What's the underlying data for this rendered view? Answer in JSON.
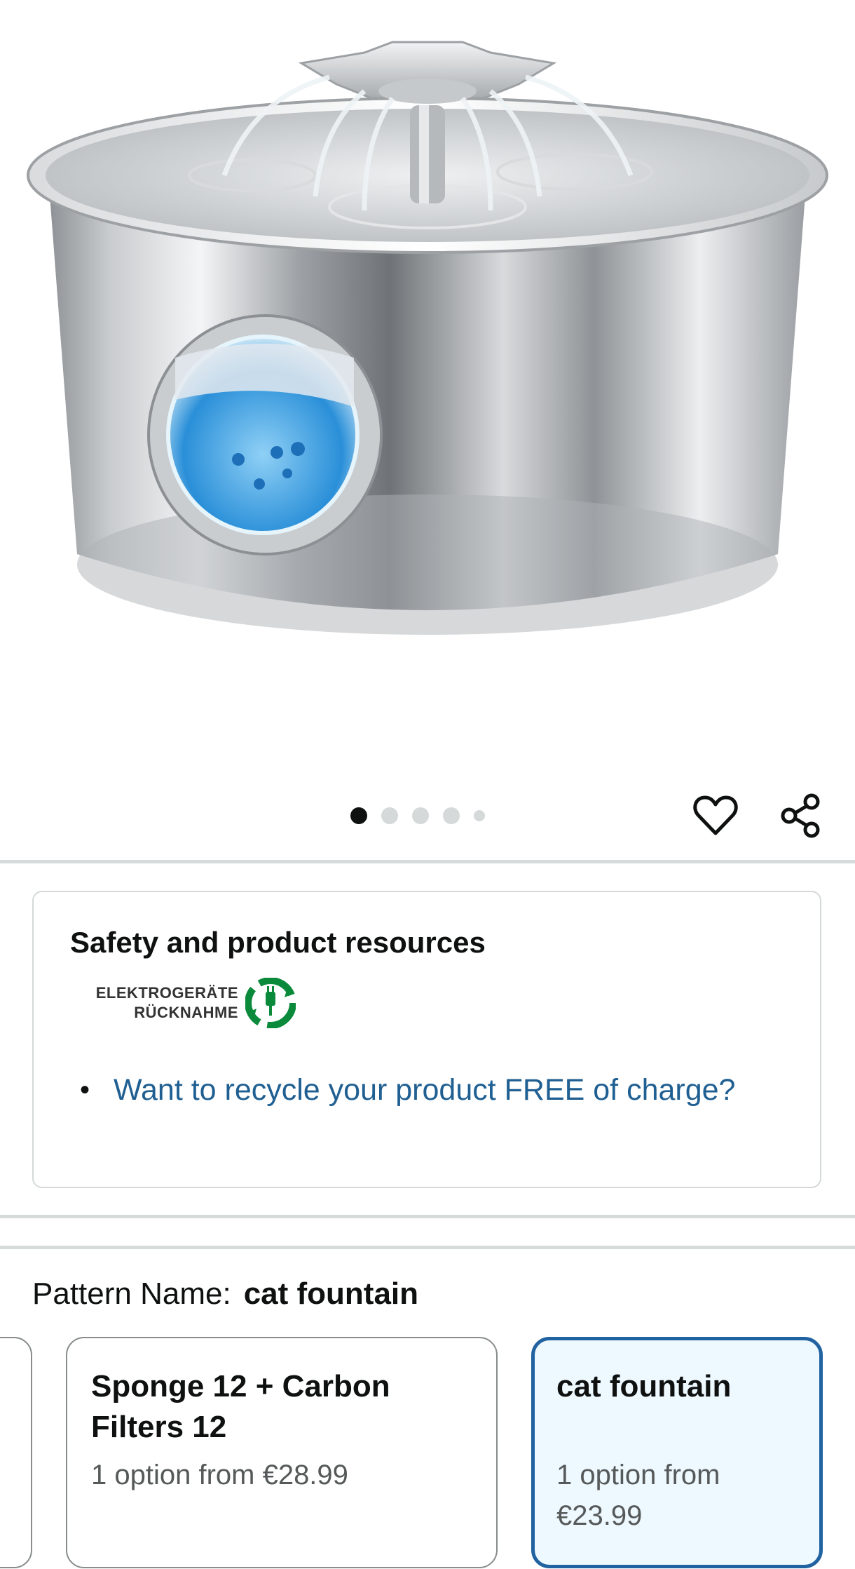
{
  "gallery": {
    "image_alt": "Stainless steel cat water fountain",
    "dot_count": 5,
    "active_index": 0,
    "wishlist_icon": "heart-icon",
    "share_icon": "share-icon"
  },
  "safety": {
    "title": "Safety and product resources",
    "logo": {
      "line1": "ELEKTROGERÄTE",
      "line2": "RÜCKNAHME",
      "color": "#0a8a3a"
    },
    "link": "Want to recycle your product FREE of charge?"
  },
  "pattern": {
    "label": "Pattern Name:",
    "selected": "cat fountain",
    "options": [
      {
        "title": "Sponge 12 + Carbon Filters 12",
        "price": "1 option from €28.99"
      },
      {
        "title": "cat fountain",
        "price": "1 option from €23.99",
        "selected": true
      }
    ]
  },
  "colors": {
    "link": "#1f5f92",
    "selected_border": "#2162a1",
    "selected_bg": "#edf8ff"
  }
}
